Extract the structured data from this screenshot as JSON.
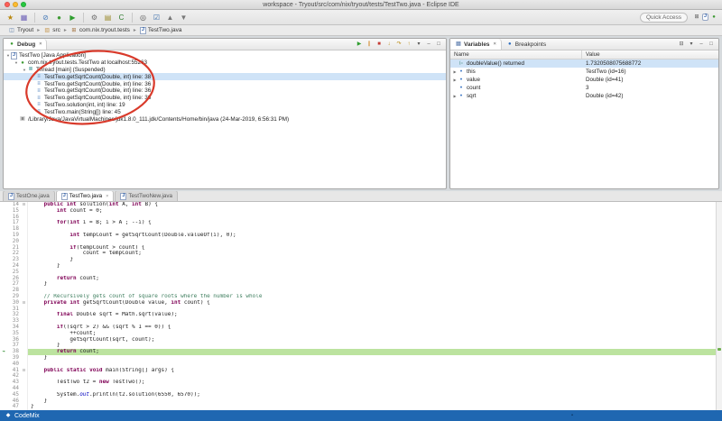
{
  "window": {
    "title": "workspace - Tryout/src/com/nix/tryout/tests/TestTwo.java - Eclipse IDE"
  },
  "toolbar": {
    "quick_access_label": "Quick Access",
    "icons": [
      "new-wizard-icon",
      "save-icon",
      "skip-breakpoints-icon",
      "debug-icon",
      "run-icon",
      "external-tools-icon",
      "coverage-icon",
      "new-class-icon",
      "search-icon",
      "task-icon",
      "prev-annotation-icon",
      "next-annotation-icon"
    ],
    "perspective_icons": [
      "open-perspective-icon",
      "java-perspective-icon",
      "debug-perspective-icon"
    ]
  },
  "breadcrumb": {
    "items": [
      {
        "label": "Tryout",
        "icon": "project-icon"
      },
      {
        "label": "src",
        "icon": "folder-icon"
      },
      {
        "label": "com.nix.tryout.tests",
        "icon": "package-icon"
      },
      {
        "label": "TestTwo.java",
        "icon": "java-file-icon"
      }
    ]
  },
  "debug_view": {
    "tab_label": "Debug",
    "toolbar_icons": [
      "resume-icon",
      "suspend-icon",
      "terminate-icon",
      "step-into-icon",
      "step-over-icon",
      "step-return-icon",
      "view-menu-icon",
      "minimize-icon",
      "maximize-icon"
    ],
    "tree": [
      {
        "label": "TestTwo [Java Application]",
        "indent": 0,
        "icon": "java-app-icon",
        "expanded": true
      },
      {
        "label": "com.nix.tryout.tests.TestTwo at localhost:55263",
        "indent": 1,
        "icon": "debug-target-icon",
        "expanded": true
      },
      {
        "label": "Thread [main] (Suspended)",
        "indent": 2,
        "icon": "thread-icon",
        "expanded": true
      },
      {
        "label": "TestTwo.getSqrtCount(Double, int) line: 38",
        "indent": 3,
        "icon": "stack-frame-icon",
        "selected": true
      },
      {
        "label": "TestTwo.getSqrtCount(Double, int) line: 36",
        "indent": 3,
        "icon": "stack-frame-icon"
      },
      {
        "label": "TestTwo.getSqrtCount(Double, int) line: 36",
        "indent": 3,
        "icon": "stack-frame-icon"
      },
      {
        "label": "TestTwo.getSqrtCount(Double, int) line: 36",
        "indent": 3,
        "icon": "stack-frame-icon"
      },
      {
        "label": "TestTwo.solution(int, int) line: 19",
        "indent": 3,
        "icon": "stack-frame-icon"
      },
      {
        "label": "TestTwo.main(String[]) line: 45",
        "indent": 3,
        "icon": "stack-frame-icon"
      },
      {
        "label": "/Library/Java/JavaVirtualMachines/jdk1.8.0_111.jdk/Contents/Home/bin/java (24-Mar-2019, 6:56:31 PM)",
        "indent": 1,
        "icon": "process-icon"
      }
    ],
    "annotation": {
      "shape": "ellipse",
      "color": "#d93a2b"
    }
  },
  "variables_view": {
    "tabs": [
      {
        "label": "Variables",
        "icon": "variables-icon",
        "active": true
      },
      {
        "label": "Breakpoints",
        "icon": "breakpoints-icon",
        "active": false
      }
    ],
    "toolbar_icons": [
      "collapse-all-icon",
      "view-menu-icon",
      "minimize-icon",
      "maximize-icon"
    ],
    "columns": [
      "Name",
      "Value"
    ],
    "rows": [
      {
        "name": "doubleValue() returned",
        "value": "1.7320508075688772",
        "icon": "returned-value-icon",
        "selected": true
      },
      {
        "name": "this",
        "value": "TestTwo (id=16)",
        "icon": "variable-icon",
        "expandable": true
      },
      {
        "name": "value",
        "value": "Double (id=41)",
        "icon": "variable-icon",
        "expandable": true
      },
      {
        "name": "count",
        "value": "3",
        "icon": "variable-icon"
      },
      {
        "name": "sqrt",
        "value": "Double (id=42)",
        "icon": "variable-icon",
        "expandable": true
      }
    ]
  },
  "editor": {
    "tabs": [
      {
        "label": "TestOne.java",
        "icon": "java-file-icon",
        "active": false
      },
      {
        "label": "TestTwo.java",
        "icon": "java-file-icon",
        "active": true,
        "closable": true
      },
      {
        "label": "TestTwoNew.java",
        "icon": "java-file-icon",
        "active": false
      }
    ],
    "current_line": 38,
    "folded_lines": [
      14,
      30,
      41
    ],
    "lines": [
      {
        "n": 14,
        "code": "    public int solution(int A, int B) {"
      },
      {
        "n": 15,
        "code": "        int count = 0;"
      },
      {
        "n": 16,
        "code": ""
      },
      {
        "n": 17,
        "code": "        for(int i = B; i > A ; --i) {"
      },
      {
        "n": 18,
        "code": ""
      },
      {
        "n": 19,
        "code": "            int tempCount = getSqrtCount(Double.valueOf(i), 0);"
      },
      {
        "n": 20,
        "code": ""
      },
      {
        "n": 21,
        "code": "            if(tempCount > count) {"
      },
      {
        "n": 22,
        "code": "                count = tempCount;"
      },
      {
        "n": 23,
        "code": "            }"
      },
      {
        "n": 24,
        "code": "        }"
      },
      {
        "n": 25,
        "code": ""
      },
      {
        "n": 26,
        "code": "        return count;"
      },
      {
        "n": 27,
        "code": "    }"
      },
      {
        "n": 28,
        "code": ""
      },
      {
        "n": 29,
        "code": "    // Recursively gets count of square roots where the number is whole"
      },
      {
        "n": 30,
        "code": "    private int getSqrtCount(Double value, int count) {"
      },
      {
        "n": 31,
        "code": ""
      },
      {
        "n": 32,
        "code": "        final Double sqrt = Math.sqrt(value);"
      },
      {
        "n": 33,
        "code": ""
      },
      {
        "n": 34,
        "code": "        if((sqrt > 2) && (sqrt % 1 == 0)) {"
      },
      {
        "n": 35,
        "code": "            ++count;"
      },
      {
        "n": 36,
        "code": "            getSqrtCount(sqrt, count);"
      },
      {
        "n": 37,
        "code": "        }"
      },
      {
        "n": 38,
        "code": "        return count;"
      },
      {
        "n": 39,
        "code": "    }"
      },
      {
        "n": 40,
        "code": ""
      },
      {
        "n": 41,
        "code": "    public static void main(String[] args) {"
      },
      {
        "n": 42,
        "code": ""
      },
      {
        "n": 43,
        "code": "        TestTwo t2 = new TestTwo();"
      },
      {
        "n": 44,
        "code": ""
      },
      {
        "n": 45,
        "code": "        System.out.println(t2.solution(6550, 6570));"
      },
      {
        "n": 46,
        "code": "    }"
      },
      {
        "n": 47,
        "code": "}"
      }
    ]
  },
  "status_bar": {
    "label": "CodeMix"
  }
}
